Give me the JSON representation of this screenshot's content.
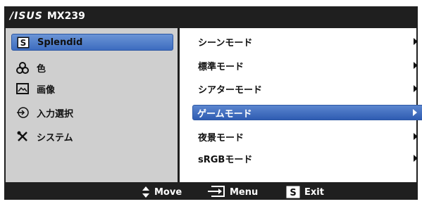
{
  "header": {
    "logo": "/ISUS",
    "model": "MX239"
  },
  "sidebar": {
    "items": [
      {
        "label": "Splendid",
        "icon": "splendid-icon",
        "selected": true
      },
      {
        "label": "色",
        "icon": "color-icon",
        "selected": false
      },
      {
        "label": "画像",
        "icon": "image-icon",
        "selected": false
      },
      {
        "label": "入力選択",
        "icon": "input-select-icon",
        "selected": false
      },
      {
        "label": "システム",
        "icon": "system-tools-icon",
        "selected": false
      }
    ]
  },
  "submenu": {
    "items": [
      {
        "label": "シーンモード",
        "selected": false
      },
      {
        "label": "標準モード",
        "selected": false
      },
      {
        "label": "シアターモード",
        "selected": false
      },
      {
        "label": "ゲームモード",
        "selected": true
      },
      {
        "label": "夜景モード",
        "selected": false
      },
      {
        "label": "sRGBモード",
        "selected": false
      }
    ]
  },
  "footer": {
    "move_label": "Move",
    "menu_label": "Menu",
    "exit_label": "Exit",
    "exit_key": "S"
  },
  "colors": {
    "background": "#1f1f1f",
    "left_panel": "#cfcfcf",
    "highlight": "#3d6cc0"
  }
}
